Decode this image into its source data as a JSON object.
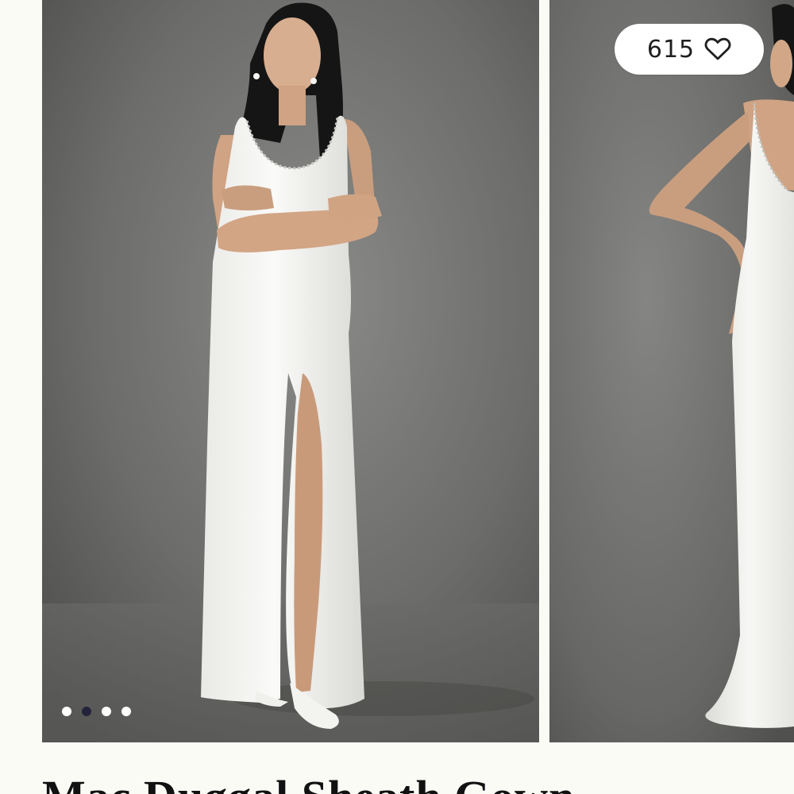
{
  "likes": {
    "count": "615",
    "icon": "heart-outline-icon"
  },
  "carousel": {
    "slide_count": 4,
    "active_index": 1,
    "slides": [
      {
        "alt": "Model in white column gown with front slit, arms crossed"
      },
      {
        "alt": "Model in white gown showing open back"
      }
    ]
  },
  "product": {
    "title": "Mac Duggal Sheath Gown"
  }
}
